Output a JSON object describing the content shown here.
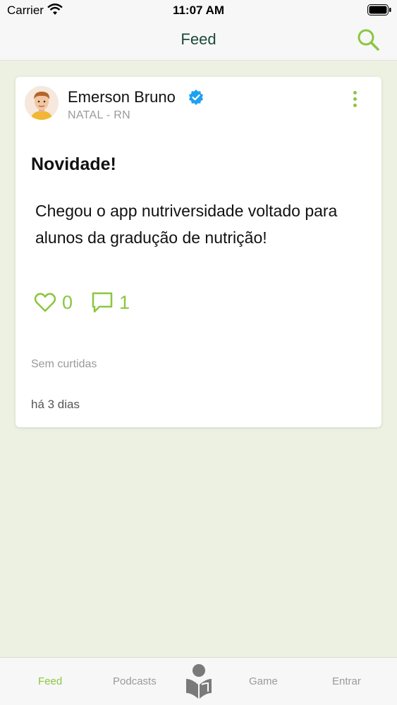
{
  "status_bar": {
    "carrier": "Carrier",
    "time": "11:07 AM"
  },
  "nav": {
    "title": "Feed",
    "search_icon": "search-icon"
  },
  "colors": {
    "accent": "#8cc63f",
    "nav_title": "#1b4a3a",
    "verified": "#1da1f2",
    "muted": "#9a9a9a",
    "background": "#edf1e2"
  },
  "post": {
    "author_name": "Emerson Bruno",
    "author_location": "NATAL - RN",
    "title": "Novidade!",
    "body": "Chegou o app nutriversidade voltado para alunos da gradução de nutrição!",
    "like_count": "0",
    "comment_count": "1",
    "likes_text": "Sem curtidas",
    "time_ago": "há 3 dias"
  },
  "tabs": {
    "feed": "Feed",
    "podcasts": "Podcasts",
    "game": "Game",
    "entrar": "Entrar"
  }
}
